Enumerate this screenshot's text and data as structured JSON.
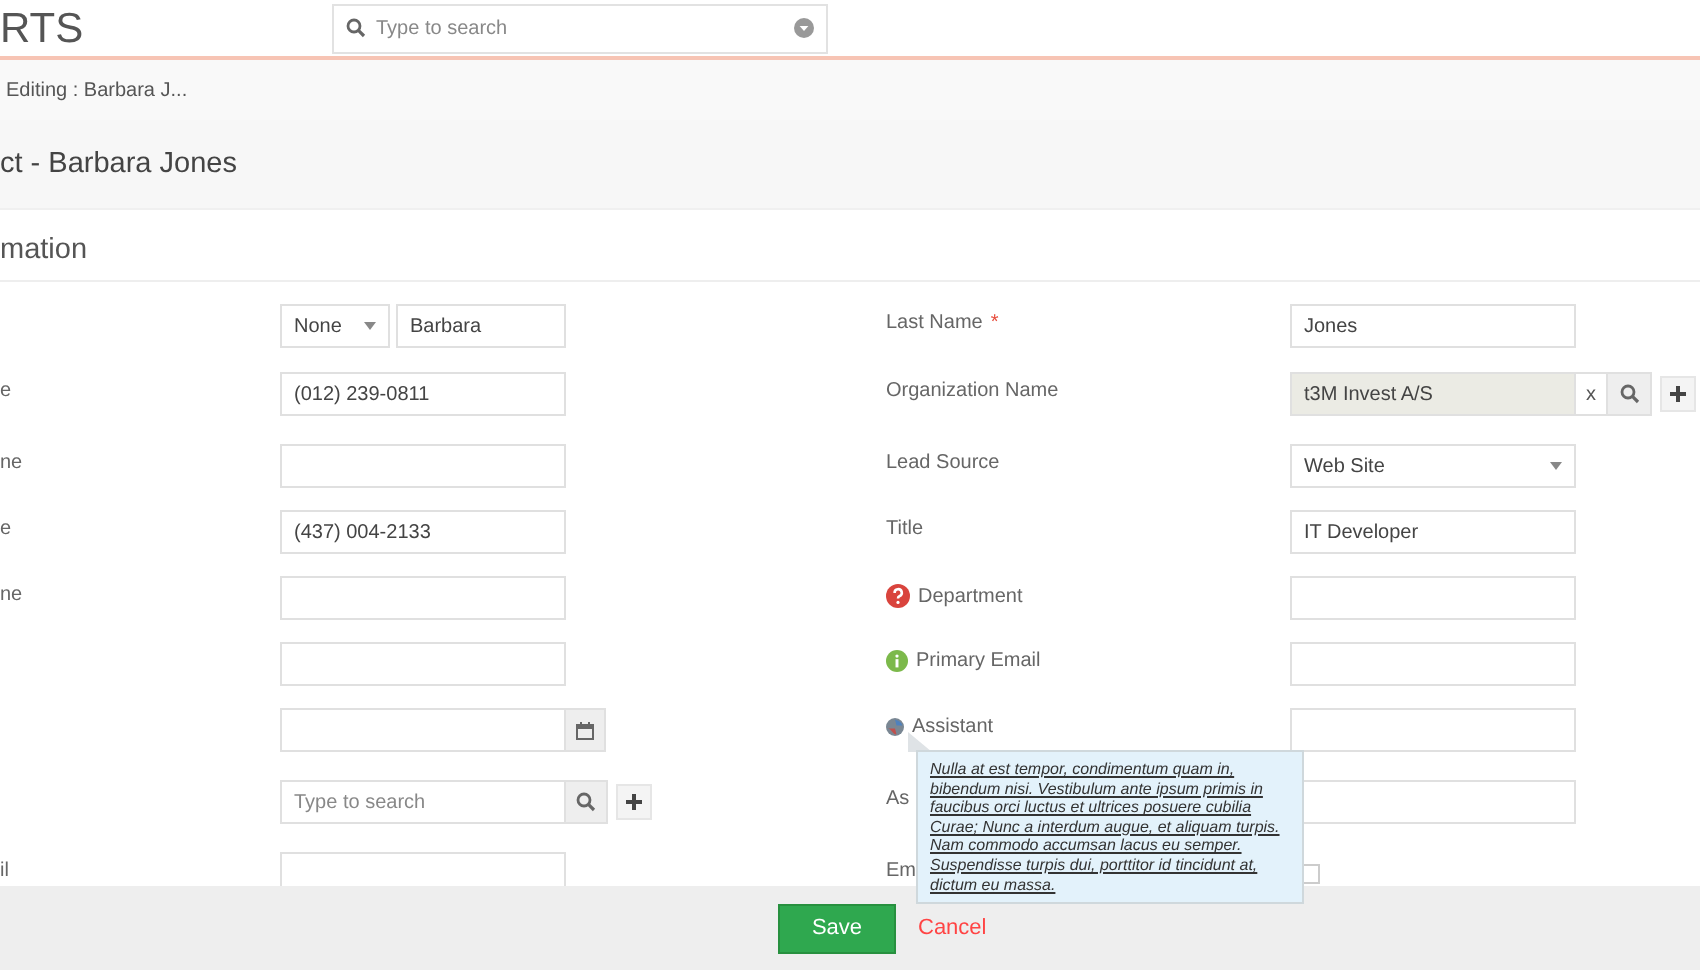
{
  "header": {
    "logo": "RTS",
    "search": {
      "placeholder": "Type to search"
    }
  },
  "breadcrumb": "Editing : Barbara J...",
  "page_title": "ct - Barbara Jones",
  "section_title": "mation",
  "left_fields": [
    {
      "kind": "salutation",
      "option": "None",
      "value": "Barbara"
    },
    {
      "label": "e",
      "kind": "text",
      "value": "(012) 239-0811"
    },
    {
      "label": "ne",
      "kind": "text"
    },
    {
      "label": "e",
      "kind": "text",
      "value": "(437) 004-2133"
    },
    {
      "label": "ne",
      "kind": "text"
    },
    {
      "kind": "text"
    },
    {
      "kind": "date"
    },
    {
      "kind": "lookup",
      "placeholder": "Type to search"
    },
    {
      "label": "il",
      "kind": "text"
    }
  ],
  "right_fields": [
    {
      "label": "Last Name",
      "required_mark": "*",
      "kind": "text",
      "value": "Jones"
    },
    {
      "label": "Organization Name",
      "kind": "lookup_filled",
      "value": "t3M Invest A/S",
      "clear": "x"
    },
    {
      "label": "Lead Source",
      "kind": "select",
      "value": "Web Site"
    },
    {
      "label": "Title",
      "kind": "text",
      "value": "IT Developer"
    },
    {
      "label": "Department",
      "kind": "help"
    },
    {
      "label": "Primary Email",
      "kind": "info"
    },
    {
      "label": "Assistant",
      "kind": "tip"
    },
    {
      "label": "As",
      "kind": "text"
    },
    {
      "label": "Em",
      "kind": "checkbox",
      "checked": false
    }
  ],
  "tooltip": "Nulla at est tempor, condimentum quam in, bibendum nisi. Vestibulum ante ipsum primis in faucibus orci luctus et ultrices posuere cubilia Curae; Nunc a interdum augue, et aliquam turpis. Nam commodo accumsan lacus eu semper. Suspendisse turpis dui, porttitor id tincidunt at, dictum eu massa.",
  "footer": {
    "save": "Save",
    "cancel": "Cancel"
  }
}
